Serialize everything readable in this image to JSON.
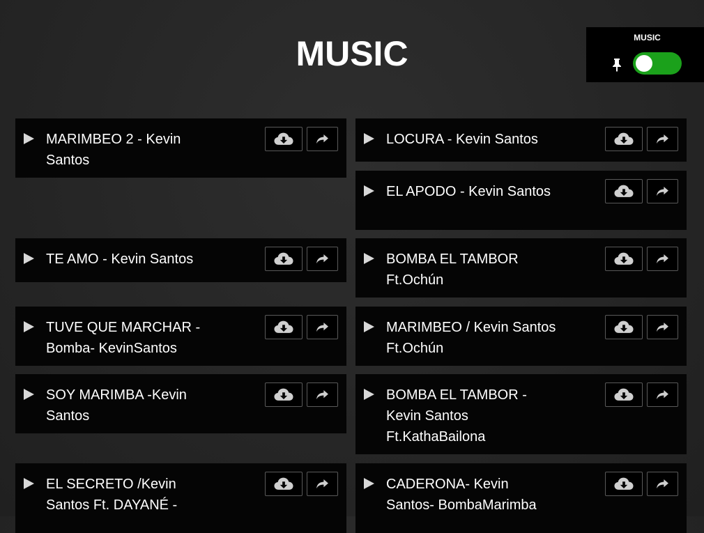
{
  "page": {
    "title": "MUSIC"
  },
  "widget": {
    "label": "MUSIC",
    "toggle_on": true,
    "accent": "#1ba11b"
  },
  "icons": {
    "play": "play-icon",
    "download": "cloud-download-icon",
    "share": "share-icon",
    "pin": "pin-icon"
  },
  "left_tracks": [
    {
      "title": "MARIMBEO 2 - Kevin Santos"
    },
    {
      "title": "TE AMO - Kevin Santos"
    },
    {
      "title": "TUVE QUE MARCHAR - Bomba- KevinSantos"
    },
    {
      "title": "SOY MARIMBA -Kevin Santos"
    },
    {
      "title": "EL SECRETO /Kevin Santos Ft. DAYANÉ -"
    }
  ],
  "right_tracks": [
    {
      "title": "LOCURA - Kevin Santos"
    },
    {
      "title": "EL APODO - Kevin Santos"
    },
    {
      "title": "BOMBA EL TAMBOR Ft.Ochún"
    },
    {
      "title": "MARIMBEO / Kevin Santos Ft.Ochún"
    },
    {
      "title": "BOMBA EL TAMBOR - Kevin Santos Ft.KathaBailona"
    },
    {
      "title": "CADERONA- Kevin Santos- BombaMarimba"
    }
  ]
}
